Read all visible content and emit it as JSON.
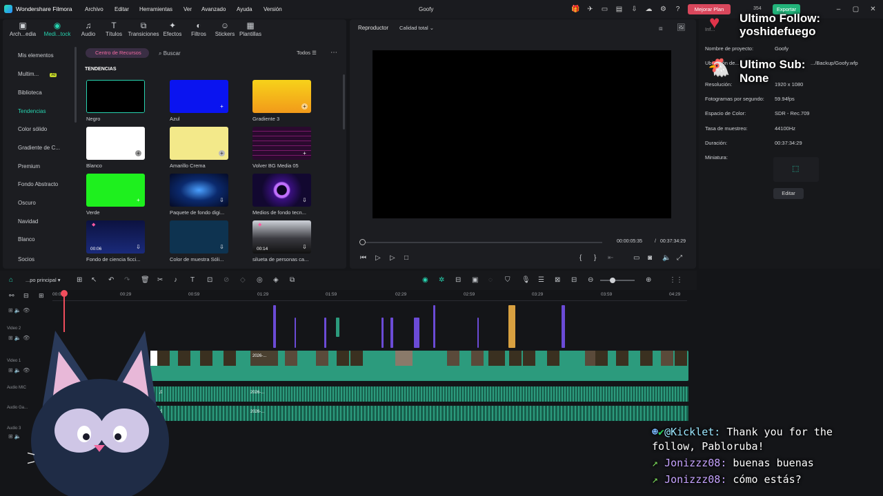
{
  "app": {
    "name": "Wondershare Filmora",
    "project_title": "Goofy"
  },
  "menu": [
    "Archivo",
    "Editar",
    "Herramientas",
    "Ver",
    "Avanzado",
    "Ayuda",
    "Versión"
  ],
  "titlebar": {
    "upgrade_label": "Mejorar Plan",
    "export_label": "Exportar",
    "credits": "354"
  },
  "media_tabs": [
    {
      "label": "Arch...edia",
      "icon": "archive-icon"
    },
    {
      "label": "Medi...tock",
      "icon": "stock-media-icon"
    },
    {
      "label": "Audio",
      "icon": "audio-icon"
    },
    {
      "label": "Títulos",
      "icon": "titles-icon"
    },
    {
      "label": "Transiciones",
      "icon": "transitions-icon"
    },
    {
      "label": "Efectos",
      "icon": "effects-icon"
    },
    {
      "label": "Filtros",
      "icon": "filters-icon"
    },
    {
      "label": "Stickers",
      "icon": "stickers-icon"
    },
    {
      "label": "Plantillas",
      "icon": "templates-icon"
    }
  ],
  "sidebar": {
    "items": [
      "Mis elementos",
      "Multim...",
      "Biblioteca",
      "Tendencias",
      "Color sólido",
      "Gradiente de C...",
      "Premium",
      "Fondo Abstracto",
      "Oscuro",
      "Navidad",
      "Blanco",
      "Socios"
    ],
    "ai_badge": "AI"
  },
  "resources": {
    "center_label": "Centro de Recursos",
    "search_placeholder": "Buscar",
    "filter_label": "Todos",
    "section_title": "TENDENCIAS"
  },
  "grid": [
    {
      "label": "Negro",
      "color": "#000000"
    },
    {
      "label": "Azul",
      "color": "#0a14f0"
    },
    {
      "label": "Gradiente 3",
      "color": "#f5c21a"
    },
    {
      "label": "Blanco",
      "color": "#ffffff"
    },
    {
      "label": "Amarillo Crema",
      "color": "#f3e98a"
    },
    {
      "label": "Volver BG Media 05",
      "color": "#3a0a3a"
    },
    {
      "label": "Verde",
      "color": "#1ef01e"
    },
    {
      "label": "Paquete de fondo digi...",
      "color": "#0b2a6e"
    },
    {
      "label": "Medios de fondo tecn...",
      "color": "#1a0a3a"
    },
    {
      "label": "Fondo de ciencia ficci...",
      "color": "#101a4a",
      "duration": "00:06"
    },
    {
      "label": "Color de muestra Sóli...",
      "color": "#0e3350"
    },
    {
      "label": "silueta de personas ca...",
      "color": "#2a2a30",
      "duration": "00:14"
    }
  ],
  "player": {
    "tab_label": "Reproductor",
    "quality_label": "Calidad total",
    "current_time": "00:00:05:35",
    "separator": "/",
    "total_time": "00:37:34:29",
    "progress": 0.0
  },
  "properties": {
    "header": "Inf...",
    "rows": [
      {
        "label": "Nombre de proyecto:",
        "value": "Goofy"
      },
      {
        "label": "Ubicación de...",
        "value": ".../Backup/Goofy.wfp"
      },
      {
        "label": "Resolución:",
        "value": "1920 x 1080"
      },
      {
        "label": "Fotogramas por segundo:",
        "value": "59.94fps"
      },
      {
        "label": "Espacio de Color:",
        "value": "SDR - Rec.709"
      },
      {
        "label": "Tasa de muestreo:",
        "value": "44100Hz"
      },
      {
        "label": "Duración:",
        "value": "00:37:34:29"
      },
      {
        "label": "Miniatura:",
        "value": ""
      }
    ],
    "edit_label": "Editar"
  },
  "timeline": {
    "track_selector": "...po principal",
    "ruler": [
      "00:00",
      "00:29",
      "00:59",
      "01:29",
      "01:59",
      "02:29",
      "02:59",
      "03:29",
      "03:59",
      "04:29"
    ],
    "tracks": [
      "Video 2",
      "Video 1",
      "Audio MIC",
      "Audio Ga...",
      "Audio 3"
    ],
    "clip_label": "2026-..."
  },
  "overlays": {
    "follow_title": "Ultimo Follow:",
    "follow_name": "yoshidefuego",
    "sub_title": "Ultimo Sub:",
    "sub_name": "None"
  },
  "chat": [
    {
      "user": "@Kicklet:",
      "message": "Thank you for the",
      "cont": "follow, Pabloruba!"
    },
    {
      "user": "Jonizzz08:",
      "message": "buenas buenas"
    },
    {
      "user": "Jonizzz08:",
      "message": "cómo estás?"
    }
  ],
  "colors": {
    "accent": "#27d4b0",
    "clip": "#2c9b7d",
    "purple_marker": "#6b4bd6",
    "orange_marker": "#d8a040"
  }
}
